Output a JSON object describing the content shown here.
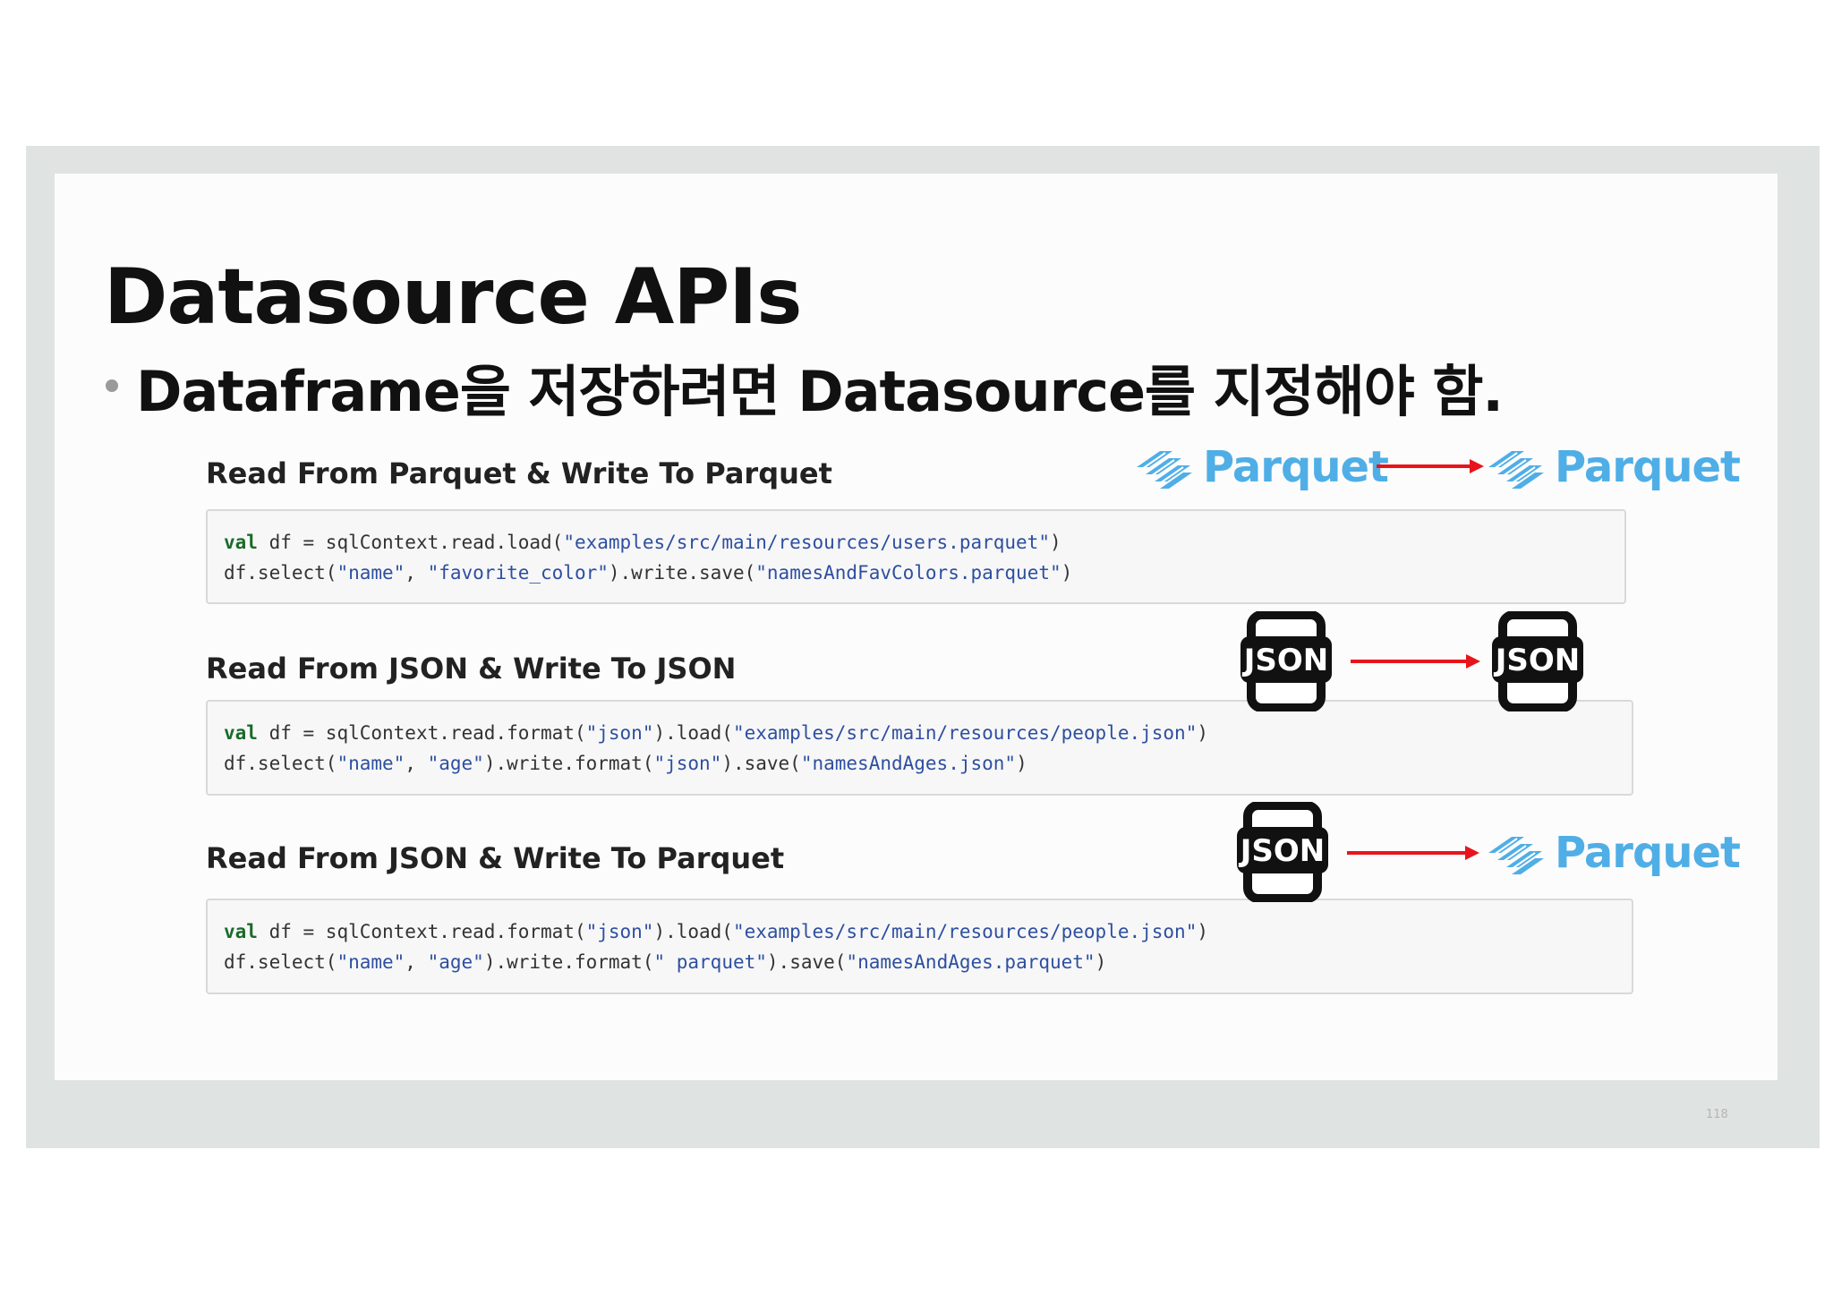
{
  "slide": {
    "title": "Datasource APIs",
    "bullet": "Dataframe을 저장하려면 Datasource를 지정해야 함.",
    "page_number": "118"
  },
  "sections": [
    {
      "label": "Read From Parquet & Write To Parquet",
      "source_format": "Parquet",
      "target_format": "Parquet",
      "code_line1": {
        "kw": "val",
        "a": " df = sqlContext.read.load(",
        "s1": "\"examples/src/main/resources/users.parquet\"",
        "b": ")"
      },
      "code_line2": {
        "a": "df.select(",
        "s1": "\"name\"",
        "b": ", ",
        "s2": "\"favorite_color\"",
        "c": ").write.save(",
        "s3": "\"namesAndFavColors.parquet\"",
        "d": ")"
      }
    },
    {
      "label": "Read From JSON & Write To JSON",
      "source_format": "JSON",
      "target_format": "JSON",
      "code_line1": {
        "kw": "val",
        "a": " df = sqlContext.read.format(",
        "s1": "\"json\"",
        "b": ").load(",
        "s2": "\"examples/src/main/resources/people.json\"",
        "c": ")"
      },
      "code_line2": {
        "a": "df.select(",
        "s1": "\"name\"",
        "b": ", ",
        "s2": "\"age\"",
        "c": ").write.format(",
        "s3": "\"json\"",
        "d": ").save(",
        "s4": "\"namesAndAges.json\"",
        "e": ")"
      }
    },
    {
      "label": "Read From JSON & Write To Parquet",
      "source_format": "JSON",
      "target_format": "Parquet",
      "code_line1": {
        "kw": "val",
        "a": " df = sqlContext.read.format(",
        "s1": "\"json\"",
        "b": ").load(",
        "s2": "\"examples/src/main/resources/people.json\"",
        "c": ")"
      },
      "code_line2": {
        "a": "df.select(",
        "s1": "\"name\"",
        "b": ", ",
        "s2": "\"age\"",
        "c": ").write.format(",
        "s3": "\" parquet\"",
        "d": ").save(",
        "s4": "\"namesAndAges.parquet\"",
        "e": ")"
      }
    }
  ],
  "colors": {
    "parquet_blue": "#50aee6",
    "arrow_red": "#e8141b",
    "keyword_green": "#1a6b2a",
    "string_blue": "#2e4fa0"
  },
  "icons": [
    "parquet-logo-icon",
    "json-file-icon",
    "right-arrow-icon"
  ]
}
